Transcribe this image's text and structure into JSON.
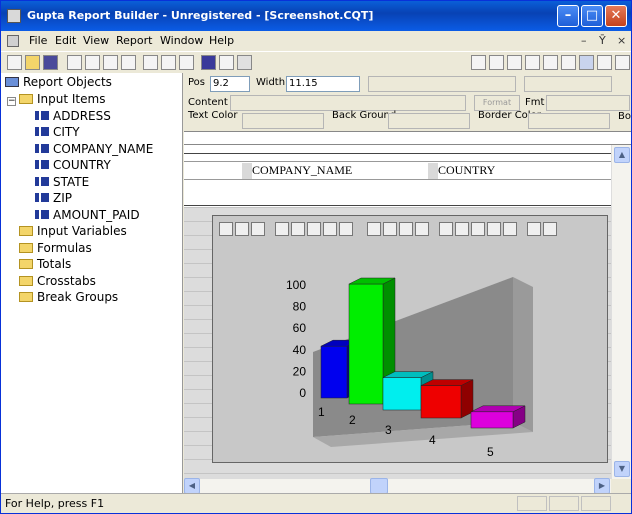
{
  "window": {
    "title": "Gupta Report Builder - Unregistered - [Screenshot.CQT]",
    "minimize": "–",
    "maximize": "□",
    "close": "✕"
  },
  "menu": {
    "items": [
      {
        "label": "File"
      },
      {
        "label": "Edit"
      },
      {
        "label": "View"
      },
      {
        "label": "Report"
      },
      {
        "label": "Window"
      },
      {
        "label": "Help"
      }
    ],
    "child_min": "–",
    "child_restore": "Ȳ",
    "child_close": "×"
  },
  "tree": {
    "root": "Report Objects",
    "input_items": "Input Items",
    "fields": [
      "ADDRESS",
      "CITY",
      "COMPANY_NAME",
      "COUNTRY",
      "STATE",
      "ZIP",
      "AMOUNT_PAID"
    ],
    "groups": [
      "Input Variables",
      "Formulas",
      "Totals",
      "Crosstabs",
      "Break Groups"
    ]
  },
  "properties": {
    "pos_label": "Pos",
    "pos_value": "9.2",
    "width_label": "Width",
    "width_value": "11.15",
    "content_label": "Content",
    "fmt_label": "Fmt",
    "format_btn": "Format",
    "text_color_label": "Text Color",
    "back_ground_label": "Back Ground",
    "border_color_label": "Border Color",
    "bo_label": "Bo"
  },
  "report": {
    "columns": [
      "COMPANY_NAME",
      "COUNTRY"
    ]
  },
  "chart_data": {
    "type": "bar",
    "categories": [
      "1",
      "2",
      "3",
      "4",
      "5"
    ],
    "values": [
      48,
      100,
      30,
      30,
      15
    ],
    "colors": [
      "#0000ee",
      "#00ee00",
      "#00eeee",
      "#ee0000",
      "#dd00dd"
    ],
    "yticks": [
      "100",
      "80",
      "60",
      "40",
      "20",
      "0"
    ],
    "ylim": [
      0,
      100
    ]
  },
  "status": {
    "text": "For Help, press F1"
  }
}
